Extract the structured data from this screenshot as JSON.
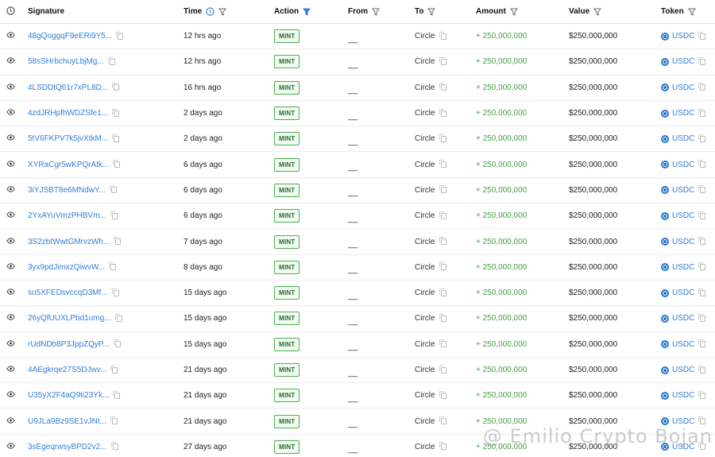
{
  "header": {
    "signature": "Signature",
    "time": "Time",
    "action": "Action",
    "from": "From",
    "to": "To",
    "amount": "Amount",
    "value": "Value",
    "token": "Token"
  },
  "colors": {
    "link": "#2f7fd6",
    "amount": "#43a047",
    "badge_border": "#4caf50",
    "filter_active": "#2f7fd6"
  },
  "rows": [
    {
      "signature": "48gQoggqF9eERi9Y5...",
      "time": "12 hrs ago",
      "action": "MINT",
      "from": "__",
      "to": "Circle",
      "amount": "+ 250,000,000",
      "value": "$250,000,000",
      "token": "USDC"
    },
    {
      "signature": "58sSHrbchuyLbjMg...",
      "time": "12 hrs ago",
      "action": "MINT",
      "from": "__",
      "to": "Circle",
      "amount": "+ 250,000,000",
      "value": "$250,000,000",
      "token": "USDC"
    },
    {
      "signature": "4LSDDtQ61r7xPL8D...",
      "time": "16 hrs ago",
      "action": "MINT",
      "from": "__",
      "to": "Circle",
      "amount": "+ 250,000,000",
      "value": "$250,000,000",
      "token": "USDC"
    },
    {
      "signature": "4zdJRHpfhWDZSfe1...",
      "time": "2 days ago",
      "action": "MINT",
      "from": "__",
      "to": "Circle",
      "amount": "+ 250,000,000",
      "value": "$250,000,000",
      "token": "USDC"
    },
    {
      "signature": "5tV6FKPV7k5jvXtkM...",
      "time": "2 days ago",
      "action": "MINT",
      "from": "__",
      "to": "Circle",
      "amount": "+ 250,000,000",
      "value": "$250,000,000",
      "token": "USDC"
    },
    {
      "signature": "XYRaCgr5wKPQrAtk...",
      "time": "6 days ago",
      "action": "MINT",
      "from": "__",
      "to": "Circle",
      "amount": "+ 250,000,000",
      "value": "$250,000,000",
      "token": "USDC"
    },
    {
      "signature": "3iYJSBT8e6MNdwY...",
      "time": "6 days ago",
      "action": "MINT",
      "from": "__",
      "to": "Circle",
      "amount": "+ 250,000,000",
      "value": "$250,000,000",
      "token": "USDC"
    },
    {
      "signature": "2YxAYuVmzPHBVm...",
      "time": "6 days ago",
      "action": "MINT",
      "from": "__",
      "to": "Circle",
      "amount": "+ 250,000,000",
      "value": "$250,000,000",
      "token": "USDC"
    },
    {
      "signature": "3S2zbtWwtGMrvzWh...",
      "time": "7 days ago",
      "action": "MINT",
      "from": "__",
      "to": "Circle",
      "amount": "+ 250,000,000",
      "value": "$250,000,000",
      "token": "USDC"
    },
    {
      "signature": "3yx9pdJimxzQiwvW...",
      "time": "8 days ago",
      "action": "MINT",
      "from": "__",
      "to": "Circle",
      "amount": "+ 250,000,000",
      "value": "$250,000,000",
      "token": "USDC"
    },
    {
      "signature": "su5XFEDsvccqD3Mf...",
      "time": "15 days ago",
      "action": "MINT",
      "from": "__",
      "to": "Circle",
      "amount": "+ 250,000,000",
      "value": "$250,000,000",
      "token": "USDC"
    },
    {
      "signature": "26yQfUUXLPbd1umg...",
      "time": "15 days ago",
      "action": "MINT",
      "from": "__",
      "to": "Circle",
      "amount": "+ 250,000,000",
      "value": "$250,000,000",
      "token": "USDC"
    },
    {
      "signature": "rUdNDb8P3JppZQyP...",
      "time": "15 days ago",
      "action": "MINT",
      "from": "__",
      "to": "Circle",
      "amount": "+ 250,000,000",
      "value": "$250,000,000",
      "token": "USDC"
    },
    {
      "signature": "4AEgkrqe27S5DJwv...",
      "time": "21 days ago",
      "action": "MINT",
      "from": "__",
      "to": "Circle",
      "amount": "+ 250,000,000",
      "value": "$250,000,000",
      "token": "USDC"
    },
    {
      "signature": "U35yX2F4aQ9ti23Yk...",
      "time": "21 days ago",
      "action": "MINT",
      "from": "__",
      "to": "Circle",
      "amount": "+ 250,000,000",
      "value": "$250,000,000",
      "token": "USDC"
    },
    {
      "signature": "U9JLa9Bz9SE1vJNt...",
      "time": "21 days ago",
      "action": "MINT",
      "from": "__",
      "to": "Circle",
      "amount": "+ 250,000,000",
      "value": "$250,000,000",
      "token": "USDC"
    },
    {
      "signature": "3sEgeqrwsyBPD2v2...",
      "time": "27 days ago",
      "action": "MINT",
      "from": "__",
      "to": "Circle",
      "amount": "+ 250,000,000",
      "value": "$250,000,000",
      "token": "USDC"
    }
  ],
  "watermark": "@ Emilio Crypto Bojan"
}
